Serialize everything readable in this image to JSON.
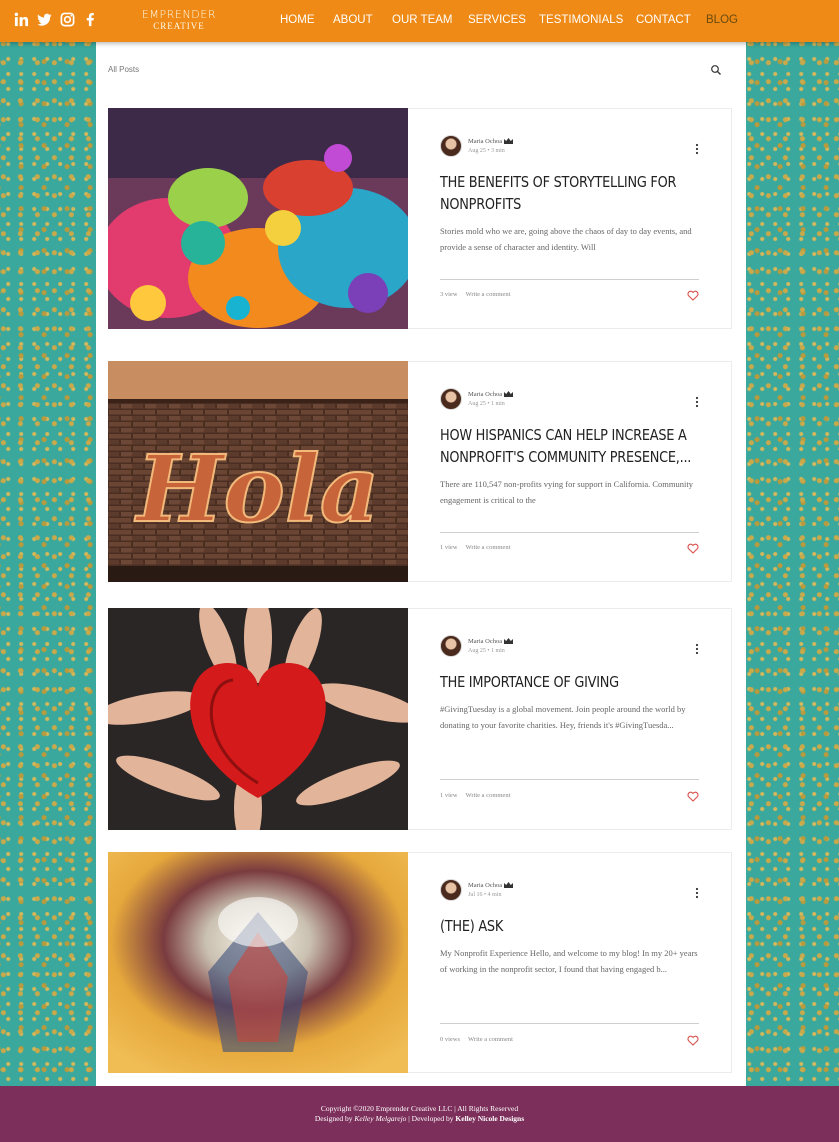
{
  "header": {
    "logo_line1": "EMPRENDER",
    "logo_line2": "CREATIVE",
    "social": [
      "linkedin-icon",
      "twitter-icon",
      "instagram-icon",
      "facebook-icon"
    ],
    "nav": [
      {
        "label": "HOME"
      },
      {
        "label": "ABOUT"
      },
      {
        "label": "OUR TEAM"
      },
      {
        "label": "SERVICES"
      },
      {
        "label": "TESTIMONIALS"
      },
      {
        "label": "CONTACT"
      },
      {
        "label": "BLOG",
        "active": true
      }
    ],
    "colors": {
      "bar": "#ee8a15",
      "active": "#6a4b10"
    }
  },
  "blog": {
    "all_posts_label": "All Posts",
    "posts": [
      {
        "author": "Maria Ochoa",
        "date": "Aug 25",
        "read_time": "3 min",
        "title": "THE BENEFITS OF STORYTELLING FOR NONPROFITS",
        "excerpt": "Stories mold who we are, going above the chaos of day to day events, and provide a sense of character and identity.  Will",
        "views": "3 view",
        "comment_label": "Write a comment",
        "image": "colorful-alebrijes-figurines"
      },
      {
        "author": "Maria Ochoa",
        "date": "Aug 25",
        "read_time": "1 min",
        "title": "HOW HISPANICS CAN HELP INCREASE A NONPROFIT'S COMMUNITY PRESENCE,...",
        "excerpt": "There are 110,547 non-profits vying for support in California.  Community engagement is critical to the",
        "views": "1 view",
        "comment_label": "Write a comment",
        "image": "hola-marquee-sign-on-brick-wall"
      },
      {
        "author": "Maria Ochoa",
        "date": "Aug 25",
        "read_time": "1 min",
        "title": "THE IMPORTANCE OF GIVING",
        "excerpt": "#GivingTuesday is a global movement. Join people around the world by donating to your favorite charities. Hey, friends it's #GivingTuesda...",
        "views": "1 view",
        "comment_label": "Write a comment",
        "image": "hands-painted-red-heart"
      },
      {
        "author": "Maria Ochoa",
        "date": "Jul 16",
        "read_time": "4 min",
        "title": "(THE) ASK",
        "excerpt": "My Nonprofit Experience Hello, and welcome to my blog!  In my 20+ years of working in the nonprofit sector, I found that having engaged b...",
        "views": "0 views",
        "comment_label": "Write a comment",
        "image": "kaleidoscope-view"
      }
    ]
  },
  "footer": {
    "line1": "Copyright ©2020 Emprender Creative LLC | All Rights Reserved",
    "designed_by_prefix": "Designed by ",
    "designer": "Kelley Melgarejo",
    "developed_by": " | Developed by ",
    "developer": "Kelley Nicole Designs",
    "color": "#7c2f5b"
  }
}
